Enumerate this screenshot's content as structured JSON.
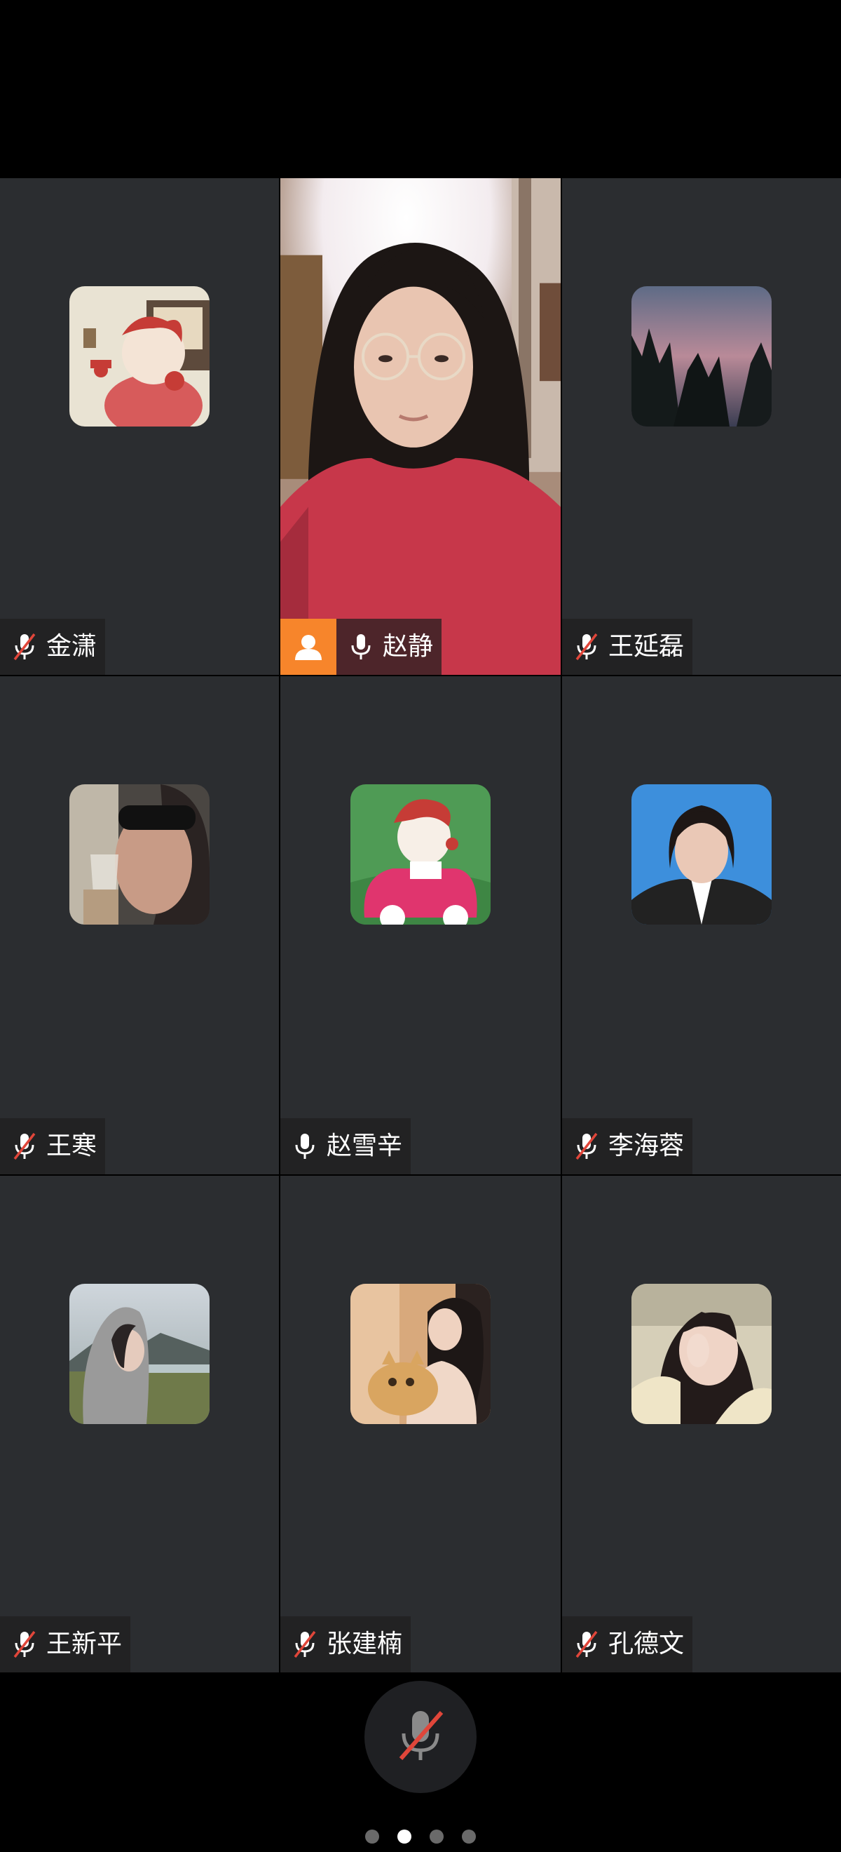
{
  "participants": [
    {
      "name": "金潇",
      "mic": "muted",
      "host": false,
      "avatar": "cartoon-girl-phone"
    },
    {
      "name": "赵静",
      "mic": "on",
      "host": true,
      "avatar": "live-video"
    },
    {
      "name": "王延磊",
      "mic": "muted",
      "host": false,
      "avatar": "sunset-trees"
    },
    {
      "name": "王寒",
      "mic": "muted",
      "host": false,
      "avatar": "woman-sunglasses"
    },
    {
      "name": "赵雪辛",
      "mic": "on",
      "host": false,
      "avatar": "cartoon-car"
    },
    {
      "name": "李海蓉",
      "mic": "muted",
      "host": false,
      "avatar": "id-photo"
    },
    {
      "name": "王新平",
      "mic": "muted",
      "host": false,
      "avatar": "woman-hoodie"
    },
    {
      "name": "张建楠",
      "mic": "muted",
      "host": false,
      "avatar": "woman-cat"
    },
    {
      "name": "孔德文",
      "mic": "muted",
      "host": false,
      "avatar": "woman-hand"
    }
  ],
  "controls": {
    "mute_icon": "mic-muted-icon"
  },
  "pagination": {
    "total": 4,
    "active": 2
  },
  "colors": {
    "host_badge": "#f7852b",
    "tile_bg": "#2b2d30",
    "mute_slash": "#e0463a"
  }
}
